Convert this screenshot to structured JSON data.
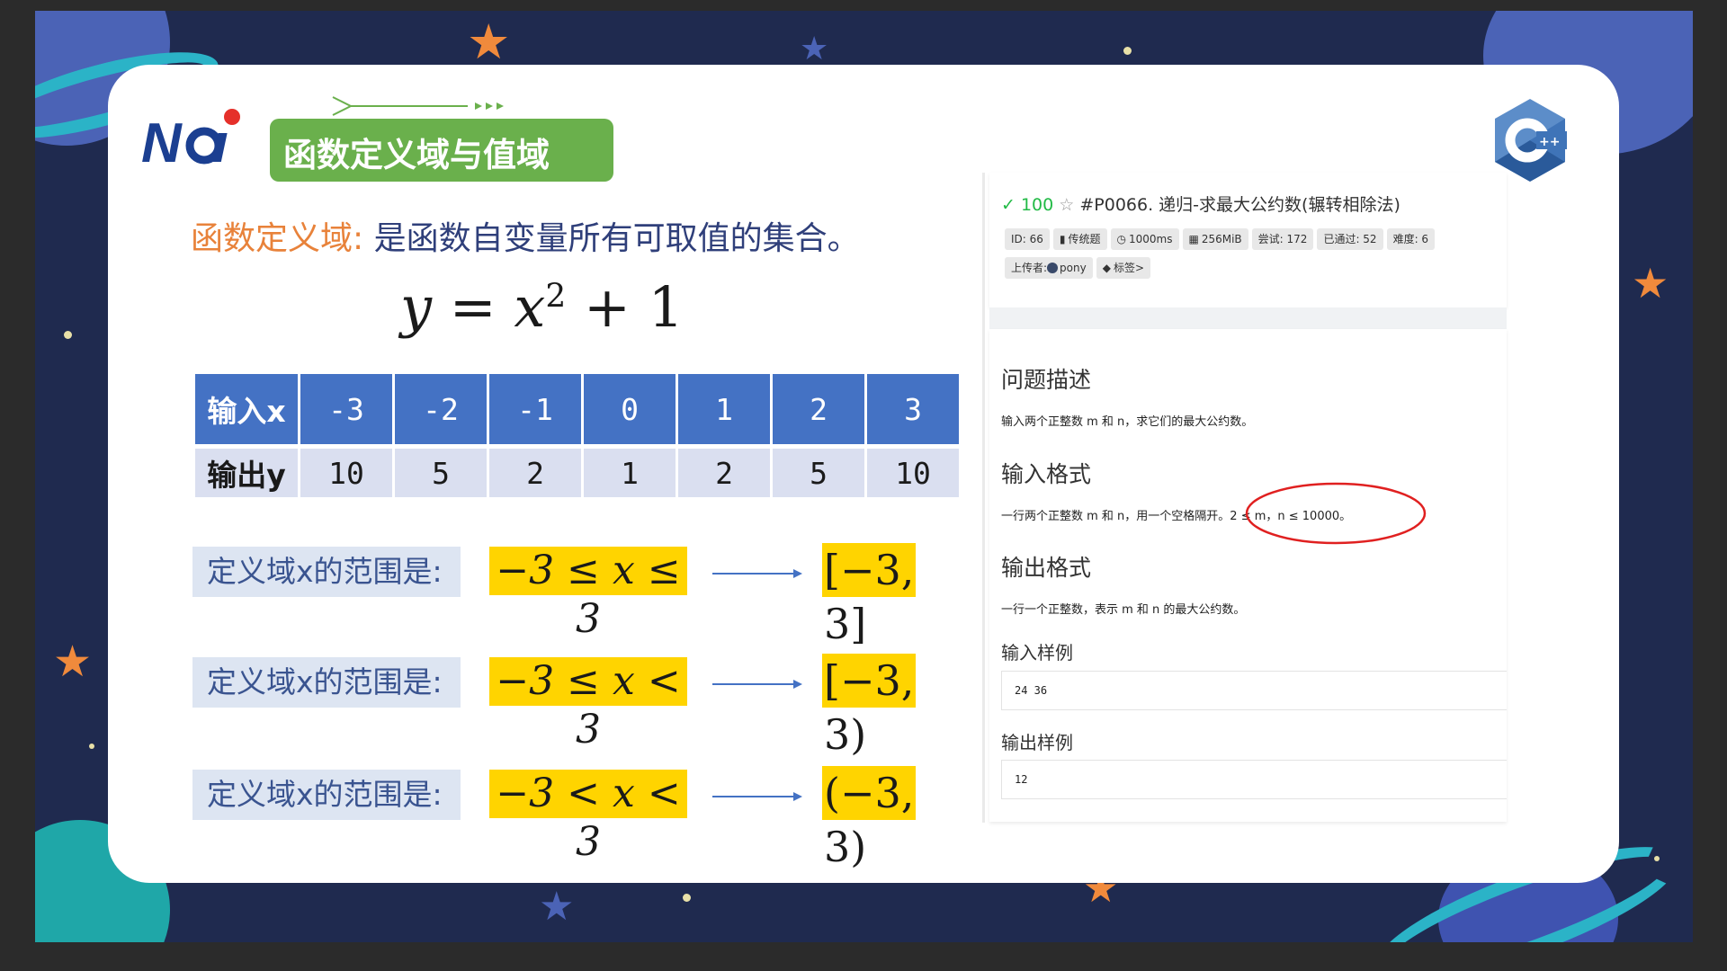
{
  "slide": {
    "logo_text": "NOI",
    "title": "函数定义域与值域",
    "definition_label": "函数定义域:",
    "definition_text": "是函数自变量所有可取值的集合。",
    "formula": {
      "lhs": "y = x",
      "exp": "2",
      "rhs": " + 1"
    }
  },
  "table": {
    "input_label": "输入x",
    "output_label": "输出y",
    "inputs": [
      "-3",
      "-2",
      "-1",
      "0",
      "1",
      "2",
      "3"
    ],
    "outputs": [
      "10",
      "5",
      "2",
      "1",
      "2",
      "5",
      "10"
    ]
  },
  "ranges": [
    {
      "label": "定义域x的范围是:",
      "inequality": "−3 ≤ x ≤ 3",
      "interval": "[−3, 3]"
    },
    {
      "label": "定义域x的范围是:",
      "inequality": "−3 ≤ x < 3",
      "interval": "[−3, 3)"
    },
    {
      "label": "定义域x的范围是:",
      "inequality": "−3 < x < 3",
      "interval": "(−3, 3)"
    }
  ],
  "problem": {
    "check": "✓",
    "score": "100",
    "star": "☆",
    "title": "#P0066. 递归-求最大公约数(辗转相除法)",
    "tags_row1": [
      {
        "icon": "",
        "text": "ID: 66"
      },
      {
        "icon": "▮",
        "text": "传统题"
      },
      {
        "icon": "◷",
        "text": "1000ms"
      },
      {
        "icon": "▦",
        "text": "256MiB"
      },
      {
        "icon": "",
        "text": "尝试: 172"
      },
      {
        "icon": "",
        "text": "已通过: 52"
      },
      {
        "icon": "",
        "text": "难度: 6"
      }
    ],
    "tags_row2": [
      {
        "icon": "",
        "text": "上传者:",
        "extra": "pony"
      },
      {
        "icon": "◆",
        "text": "标签>"
      }
    ],
    "sections": {
      "desc_h": "问题描述",
      "desc_p": "输入两个正整数 m 和 n，求它们的最大公约数。",
      "input_h": "输入格式",
      "input_p": "一行两个正整数 m 和 n，用一个空格隔开。2 ≤ m，n ≤ 10000。",
      "output_h": "输出格式",
      "output_p": "一行一个正整数，表示 m 和 n 的最大公约数。",
      "sample_in_h": "输入样例",
      "sample_in": "24 36",
      "sample_out_h": "输出样例",
      "sample_out": "12"
    }
  },
  "colors": {
    "slide_bg": "#1f2a4f",
    "title_green": "#6ab04c",
    "table_blue": "#4472c4",
    "highlight_yellow": "#ffd400",
    "orange_label": "#e8823a",
    "annotation_red": "#e02020"
  }
}
